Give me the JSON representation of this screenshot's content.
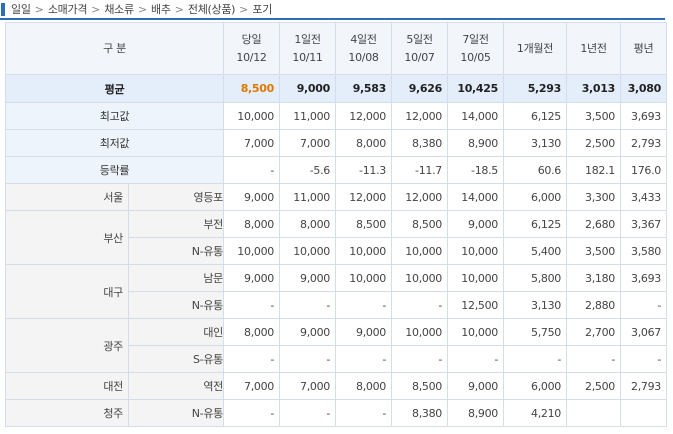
{
  "breadcrumb": [
    "일일",
    "소매가격",
    "채소류",
    "배추",
    "전체(상품)",
    "포기"
  ],
  "header": {
    "label": "구 분",
    "cols": [
      {
        "top": "당일",
        "bottom": "10/12"
      },
      {
        "top": "1일전",
        "bottom": "10/11"
      },
      {
        "top": "4일전",
        "bottom": "10/08"
      },
      {
        "top": "5일전",
        "bottom": "10/07"
      },
      {
        "top": "7일전",
        "bottom": "10/05"
      },
      {
        "top": "1개월전",
        "bottom": ""
      },
      {
        "top": "1년전",
        "bottom": ""
      },
      {
        "top": "평년",
        "bottom": ""
      }
    ]
  },
  "summary": [
    {
      "label": "평균",
      "values": [
        "8,500",
        "9,000",
        "9,583",
        "9,626",
        "10,425",
        "5,293",
        "3,013",
        "3,080"
      ]
    },
    {
      "label": "최고값",
      "values": [
        "10,000",
        "11,000",
        "12,000",
        "12,000",
        "14,000",
        "6,125",
        "3,500",
        "3,693"
      ]
    },
    {
      "label": "최저값",
      "values": [
        "7,000",
        "7,000",
        "8,000",
        "8,380",
        "8,900",
        "3,130",
        "2,500",
        "2,793"
      ]
    },
    {
      "label": "등락률",
      "values": [
        "-",
        "-5.6",
        "-11.3",
        "-11.7",
        "-18.5",
        "60.6",
        "182.1",
        "176.0"
      ]
    }
  ],
  "rows": [
    {
      "city": "서울",
      "market": "영등포",
      "values": [
        "9,000",
        "11,000",
        "12,000",
        "12,000",
        "14,000",
        "6,000",
        "3,300",
        "3,433"
      ]
    },
    {
      "city": "부산",
      "market": "부전",
      "values": [
        "8,000",
        "8,000",
        "8,500",
        "8,500",
        "9,000",
        "6,125",
        "2,680",
        "3,367"
      ]
    },
    {
      "city": "",
      "market": "N-유통",
      "values": [
        "10,000",
        "10,000",
        "10,000",
        "10,000",
        "10,000",
        "5,400",
        "3,500",
        "3,580"
      ]
    },
    {
      "city": "대구",
      "market": "남문",
      "values": [
        "9,000",
        "9,000",
        "10,000",
        "10,000",
        "10,000",
        "5,800",
        "3,180",
        "3,693"
      ]
    },
    {
      "city": "",
      "market": "N-유통",
      "values": [
        "-",
        "-",
        "-",
        "-",
        "12,500",
        "3,130",
        "2,880",
        "-"
      ]
    },
    {
      "city": "광주",
      "market": "대인",
      "values": [
        "8,000",
        "9,000",
        "9,000",
        "10,000",
        "10,000",
        "5,750",
        "2,700",
        "3,067"
      ]
    },
    {
      "city": "",
      "market": "S-유통",
      "values": [
        "-",
        "-",
        "-",
        "-",
        "-",
        "-",
        "-",
        "-"
      ]
    },
    {
      "city": "대전",
      "market": "역전",
      "values": [
        "7,000",
        "7,000",
        "8,000",
        "8,500",
        "9,000",
        "6,000",
        "2,500",
        "2,793"
      ]
    },
    {
      "city": "청주",
      "market": "N-유통",
      "values": [
        "-",
        "-",
        "-",
        "8,380",
        "8,900",
        "4,210",
        "",
        ""
      ]
    }
  ]
}
